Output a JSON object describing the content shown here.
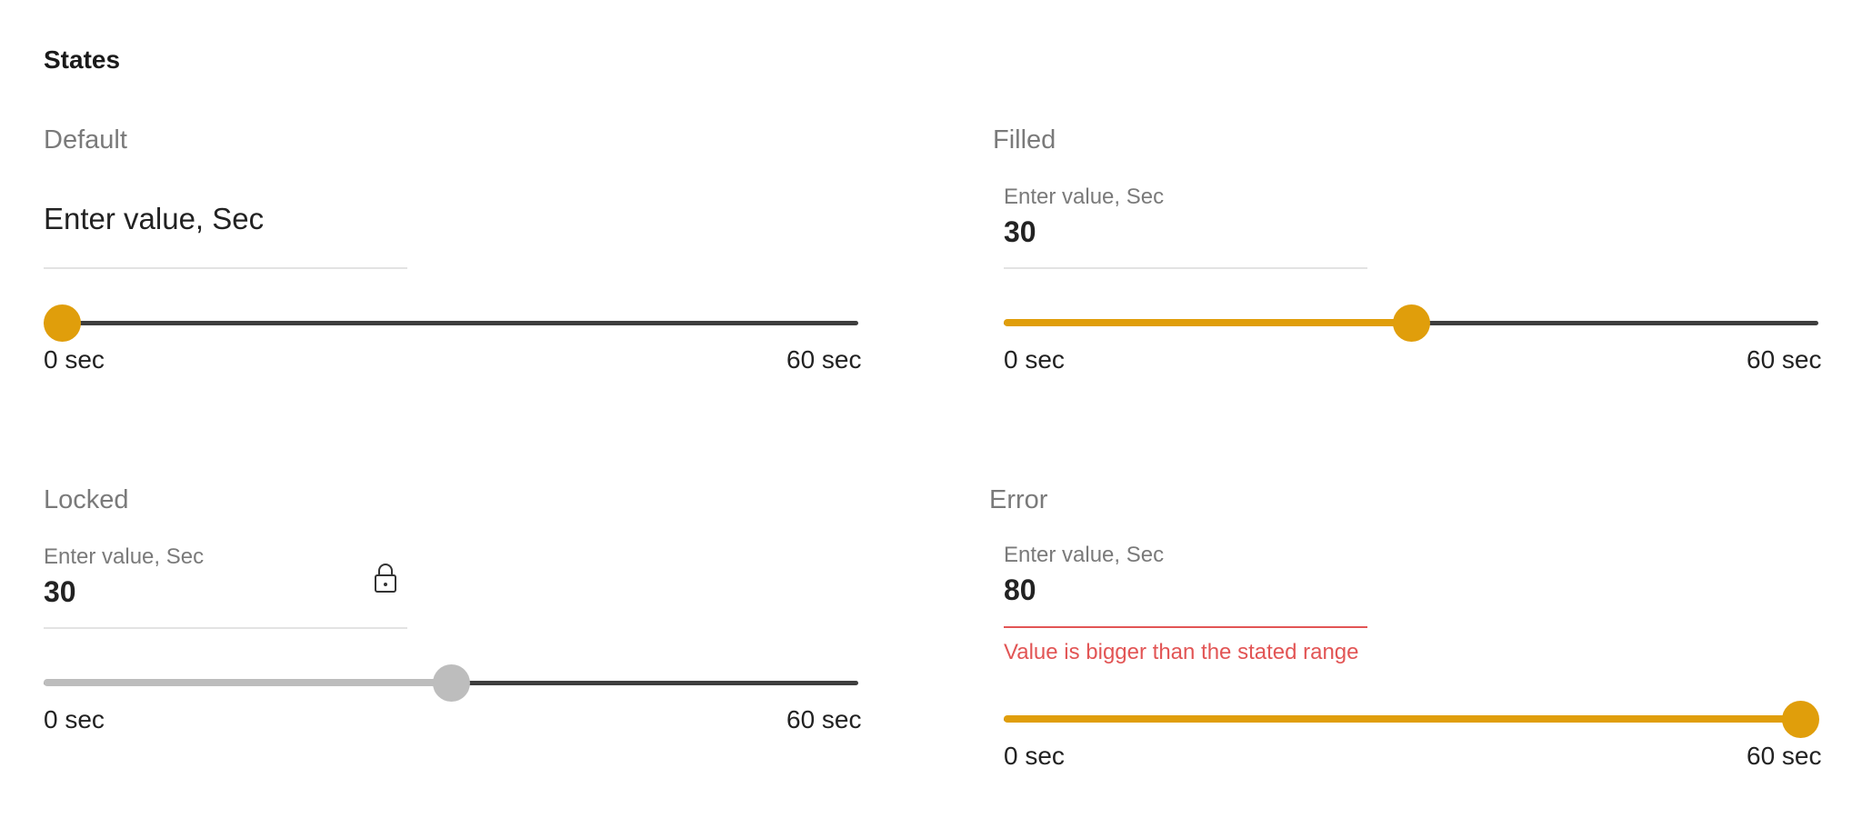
{
  "heading": "States",
  "colors": {
    "accent": "#e09e0b",
    "track": "#3e3e3e",
    "locked": "#bdbdbd",
    "error": "#e25555"
  },
  "states": {
    "default": {
      "title": "Default",
      "placeholder": "Enter value, Sec",
      "slider_value": 0,
      "min_label": "0 sec",
      "max_label": "60 sec"
    },
    "filled": {
      "title": "Filled",
      "label": "Enter value, Sec",
      "value": "30",
      "slider_value": 30,
      "min_label": "0 sec",
      "max_label": "60 sec"
    },
    "locked": {
      "title": "Locked",
      "label": "Enter value, Sec",
      "value": "30",
      "icon": "lock-icon",
      "slider_value": 30,
      "min_label": "0 sec",
      "max_label": "60 sec"
    },
    "error": {
      "title": "Error",
      "label": "Enter value, Sec",
      "value": "80",
      "error_message": "Value is bigger than the stated range",
      "slider_value": 60,
      "min_label": "0 sec",
      "max_label": "60 sec"
    }
  },
  "slider_range": {
    "min": 0,
    "max": 60
  }
}
